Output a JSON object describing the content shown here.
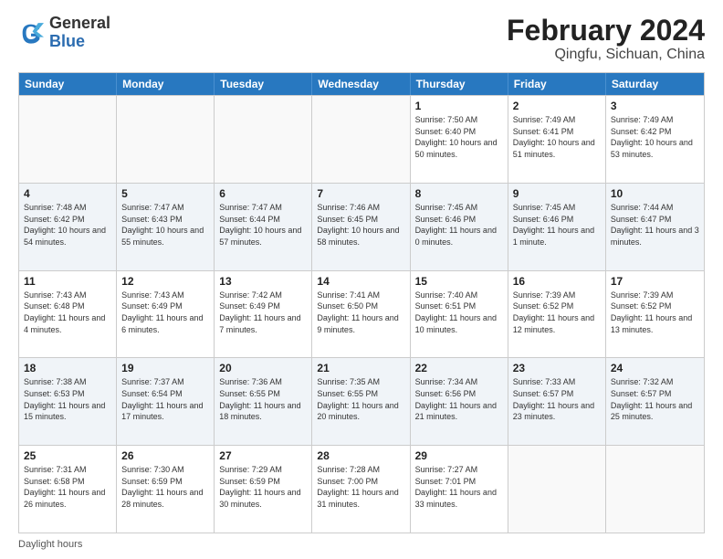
{
  "logo": {
    "general": "General",
    "blue": "Blue"
  },
  "title": "February 2024",
  "location": "Qingfu, Sichuan, China",
  "weekdays": [
    "Sunday",
    "Monday",
    "Tuesday",
    "Wednesday",
    "Thursday",
    "Friday",
    "Saturday"
  ],
  "footer": "Daylight hours",
  "rows": [
    [
      {
        "day": "",
        "info": "",
        "empty": true
      },
      {
        "day": "",
        "info": "",
        "empty": true
      },
      {
        "day": "",
        "info": "",
        "empty": true
      },
      {
        "day": "",
        "info": "",
        "empty": true
      },
      {
        "day": "1",
        "info": "Sunrise: 7:50 AM\nSunset: 6:40 PM\nDaylight: 10 hours and 50 minutes."
      },
      {
        "day": "2",
        "info": "Sunrise: 7:49 AM\nSunset: 6:41 PM\nDaylight: 10 hours and 51 minutes."
      },
      {
        "day": "3",
        "info": "Sunrise: 7:49 AM\nSunset: 6:42 PM\nDaylight: 10 hours and 53 minutes."
      }
    ],
    [
      {
        "day": "4",
        "info": "Sunrise: 7:48 AM\nSunset: 6:42 PM\nDaylight: 10 hours and 54 minutes."
      },
      {
        "day": "5",
        "info": "Sunrise: 7:47 AM\nSunset: 6:43 PM\nDaylight: 10 hours and 55 minutes."
      },
      {
        "day": "6",
        "info": "Sunrise: 7:47 AM\nSunset: 6:44 PM\nDaylight: 10 hours and 57 minutes."
      },
      {
        "day": "7",
        "info": "Sunrise: 7:46 AM\nSunset: 6:45 PM\nDaylight: 10 hours and 58 minutes."
      },
      {
        "day": "8",
        "info": "Sunrise: 7:45 AM\nSunset: 6:46 PM\nDaylight: 11 hours and 0 minutes."
      },
      {
        "day": "9",
        "info": "Sunrise: 7:45 AM\nSunset: 6:46 PM\nDaylight: 11 hours and 1 minute."
      },
      {
        "day": "10",
        "info": "Sunrise: 7:44 AM\nSunset: 6:47 PM\nDaylight: 11 hours and 3 minutes."
      }
    ],
    [
      {
        "day": "11",
        "info": "Sunrise: 7:43 AM\nSunset: 6:48 PM\nDaylight: 11 hours and 4 minutes."
      },
      {
        "day": "12",
        "info": "Sunrise: 7:43 AM\nSunset: 6:49 PM\nDaylight: 11 hours and 6 minutes."
      },
      {
        "day": "13",
        "info": "Sunrise: 7:42 AM\nSunset: 6:49 PM\nDaylight: 11 hours and 7 minutes."
      },
      {
        "day": "14",
        "info": "Sunrise: 7:41 AM\nSunset: 6:50 PM\nDaylight: 11 hours and 9 minutes."
      },
      {
        "day": "15",
        "info": "Sunrise: 7:40 AM\nSunset: 6:51 PM\nDaylight: 11 hours and 10 minutes."
      },
      {
        "day": "16",
        "info": "Sunrise: 7:39 AM\nSunset: 6:52 PM\nDaylight: 11 hours and 12 minutes."
      },
      {
        "day": "17",
        "info": "Sunrise: 7:39 AM\nSunset: 6:52 PM\nDaylight: 11 hours and 13 minutes."
      }
    ],
    [
      {
        "day": "18",
        "info": "Sunrise: 7:38 AM\nSunset: 6:53 PM\nDaylight: 11 hours and 15 minutes."
      },
      {
        "day": "19",
        "info": "Sunrise: 7:37 AM\nSunset: 6:54 PM\nDaylight: 11 hours and 17 minutes."
      },
      {
        "day": "20",
        "info": "Sunrise: 7:36 AM\nSunset: 6:55 PM\nDaylight: 11 hours and 18 minutes."
      },
      {
        "day": "21",
        "info": "Sunrise: 7:35 AM\nSunset: 6:55 PM\nDaylight: 11 hours and 20 minutes."
      },
      {
        "day": "22",
        "info": "Sunrise: 7:34 AM\nSunset: 6:56 PM\nDaylight: 11 hours and 21 minutes."
      },
      {
        "day": "23",
        "info": "Sunrise: 7:33 AM\nSunset: 6:57 PM\nDaylight: 11 hours and 23 minutes."
      },
      {
        "day": "24",
        "info": "Sunrise: 7:32 AM\nSunset: 6:57 PM\nDaylight: 11 hours and 25 minutes."
      }
    ],
    [
      {
        "day": "25",
        "info": "Sunrise: 7:31 AM\nSunset: 6:58 PM\nDaylight: 11 hours and 26 minutes."
      },
      {
        "day": "26",
        "info": "Sunrise: 7:30 AM\nSunset: 6:59 PM\nDaylight: 11 hours and 28 minutes."
      },
      {
        "day": "27",
        "info": "Sunrise: 7:29 AM\nSunset: 6:59 PM\nDaylight: 11 hours and 30 minutes."
      },
      {
        "day": "28",
        "info": "Sunrise: 7:28 AM\nSunset: 7:00 PM\nDaylight: 11 hours and 31 minutes."
      },
      {
        "day": "29",
        "info": "Sunrise: 7:27 AM\nSunset: 7:01 PM\nDaylight: 11 hours and 33 minutes."
      },
      {
        "day": "",
        "info": "",
        "empty": true
      },
      {
        "day": "",
        "info": "",
        "empty": true
      }
    ]
  ]
}
